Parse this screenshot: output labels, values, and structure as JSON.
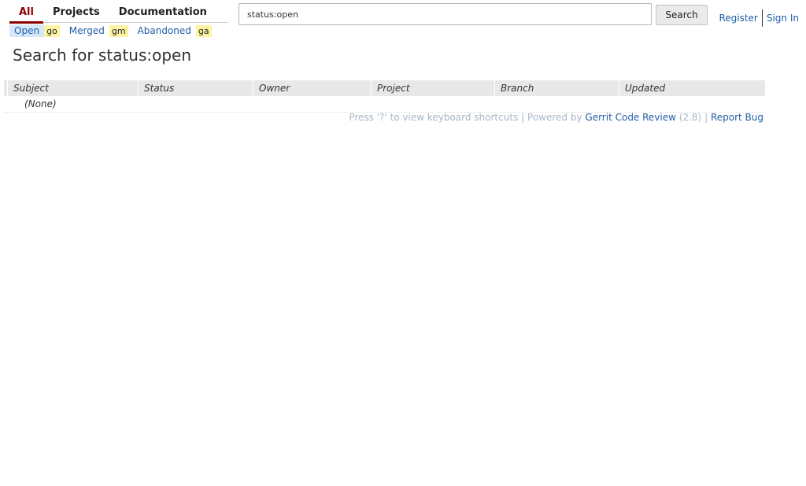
{
  "nav": {
    "menu": [
      "All",
      "Projects",
      "Documentation"
    ],
    "submenu": {
      "open": "Open",
      "open_key": "go",
      "merged": "Merged",
      "merged_key": "gm",
      "abandoned": "Abandoned",
      "abandoned_key": "ga"
    }
  },
  "search": {
    "value": "status:open",
    "button": "Search"
  },
  "account": {
    "register": "Register",
    "sign_in": "Sign In"
  },
  "page_title": "Search for status:open",
  "table": {
    "columns": [
      "Subject",
      "Status",
      "Owner",
      "Project",
      "Branch",
      "Updated"
    ],
    "empty": "(None)"
  },
  "footer": {
    "shortcuts": "Press '?' to view keyboard shortcuts",
    "pipe": "|",
    "powered_by": "Powered by",
    "gerrit": "Gerrit Code Review",
    "version": "(2.8)",
    "report_bug": "Report Bug"
  }
}
